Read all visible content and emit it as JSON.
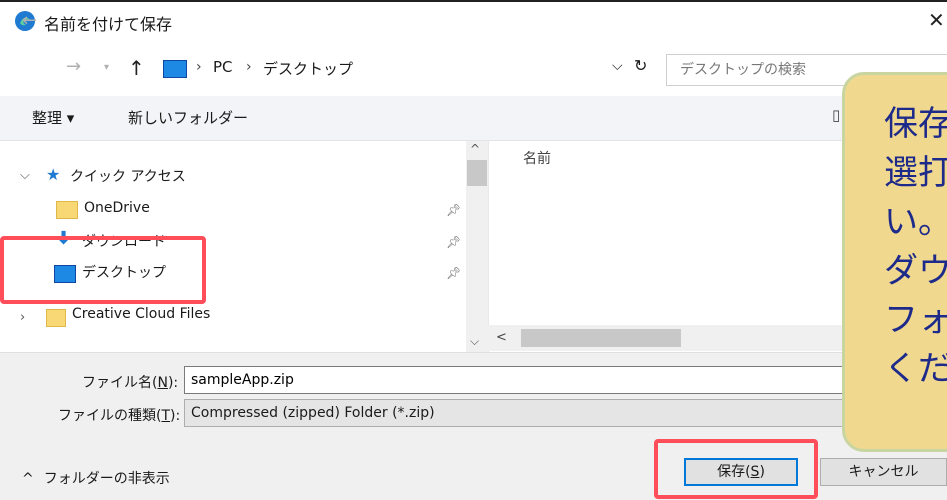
{
  "window": {
    "title": "名前を付けて保存",
    "close_glyph": "✕"
  },
  "address": {
    "crumbs": [
      "PC",
      "デスクトップ"
    ],
    "separator": "›",
    "dropdown_glyph": "⌵",
    "refresh_glyph": "↻",
    "search_placeholder": "デスクトップの検索"
  },
  "nav_buttons": {
    "back": "←",
    "forward": "→",
    "up": "↑"
  },
  "toolbar": {
    "organize": "整理 ▾",
    "new_folder": "新しいフォルダー",
    "view_glyph": "▯"
  },
  "sidebar": {
    "quick_access": "クイック アクセス",
    "items": [
      {
        "label": "OneDrive",
        "pinned": true
      },
      {
        "label": "ダウンロード",
        "pinned": true
      },
      {
        "label": "デスクトップ",
        "pinned": true
      }
    ],
    "creative_cloud": "Creative Cloud Files"
  },
  "filelist": {
    "column_name": "名前"
  },
  "form": {
    "filename_label_pre": "ファイル名(",
    "filename_label_key": "N",
    "filename_label_post": "):",
    "filename_value": "sampleApp.zip",
    "filetype_label_pre": "ファイルの種類(",
    "filetype_label_key": "T",
    "filetype_label_post": "):",
    "filetype_value": "Compressed (zipped) Folder (*.zip)",
    "hide_folders": "フォルダーの非表示",
    "hide_glyph": "^",
    "save_pre": "保存(",
    "save_key": "S",
    "save_post": ")",
    "cancel": "キャンセル"
  },
  "callout": {
    "text": "保存\n選打\nい。\nダウ\nフォ\nくだ"
  },
  "colors": {
    "highlight": "#ff4d5a",
    "callout_bg": "#f0d98e",
    "callout_text": "#1e2a8a",
    "accent": "#0078d7"
  }
}
